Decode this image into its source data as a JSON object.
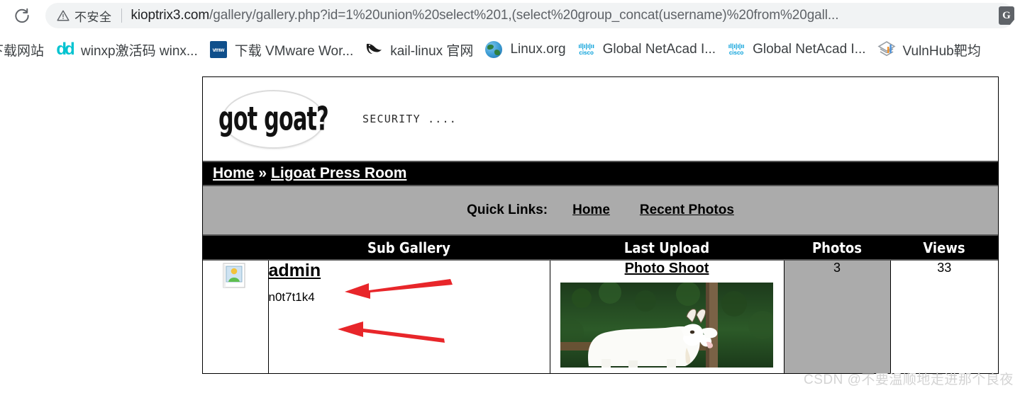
{
  "browser": {
    "reload_icon": "reload-icon",
    "security_label": "不安全",
    "security_icon": "warning-triangle-icon",
    "url_host": "kioptrix3.com",
    "url_path": "/gallery/gallery.php?id=1%20union%20select%201,(select%20group_concat(username)%20from%20gall...",
    "extension_label": "G",
    "bookmarks": [
      {
        "label": "下载网站",
        "icon": "download-site-icon"
      },
      {
        "label": "winxp激活码 winx...",
        "icon": "dd-icon"
      },
      {
        "label": "下载 VMware Wor...",
        "icon": "vmware-icon"
      },
      {
        "label": "kail-linux 官网",
        "icon": "kali-dragon-icon"
      },
      {
        "label": "Linux.org",
        "icon": "globe-icon"
      },
      {
        "label": "Global NetAcad I...",
        "icon": "cisco-icon"
      },
      {
        "label": "Global NetAcad I...",
        "icon": "cisco-icon"
      },
      {
        "label": "VulnHub靶均",
        "icon": "vulnhub-icon"
      }
    ]
  },
  "site": {
    "logo_text": "got goat?",
    "tagline": "SECURITY ....",
    "breadcrumb": {
      "home": "Home",
      "separator": "»",
      "current": "Ligoat Press Room"
    },
    "quick_links": {
      "label": "Quick Links:",
      "items": [
        "Home",
        "Recent Photos"
      ]
    },
    "table": {
      "headers": [
        "Sub Gallery",
        "Last Upload",
        "Photos",
        "Views"
      ],
      "rows": [
        {
          "thumb_icon": "gallery-thumbnail-icon",
          "name": "admin",
          "subtext": "n0t7t1k4",
          "upload_title": "Photo Shoot",
          "upload_image": "white-goat-photo",
          "photos": "3",
          "views": "33"
        }
      ]
    }
  },
  "watermark": "CSDN @不要温顺地走进那个良夜",
  "colors": {
    "nav_black": "#000000",
    "bar_gray": "#ababab",
    "arrow_red": "#e8262a",
    "chrome_gray": "#f1f3f4"
  }
}
